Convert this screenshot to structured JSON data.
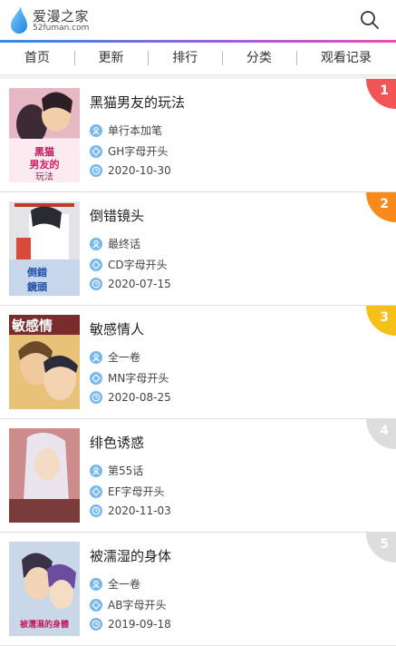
{
  "header": {
    "logo_name": "爱漫之家",
    "logo_url": "52fuman.com",
    "brand_color": "#2f8de6"
  },
  "nav": [
    "首页",
    "更新",
    "排行",
    "分类",
    "观看记录"
  ],
  "rank_colors": [
    "#f15555",
    "#f7891d",
    "#f6c01b",
    "#dddddd",
    "#dddddd"
  ],
  "items": [
    {
      "rank": "1",
      "title": "黑猫男友的玩法",
      "chapter": "单行本加笔",
      "category": "GH字母开头",
      "date": "2020-10-30",
      "cover_text": [
        "黑猫",
        "男友的",
        "玩法"
      ]
    },
    {
      "rank": "2",
      "title": "倒错镜头",
      "chapter": "最终话",
      "category": "CD字母开头",
      "date": "2020-07-15",
      "cover_text": [
        "倒錯",
        "鏡頭"
      ]
    },
    {
      "rank": "3",
      "title": "敏感情人",
      "chapter": "全一卷",
      "category": "MN字母开头",
      "date": "2020-08-25",
      "cover_text": [
        "敏感情"
      ]
    },
    {
      "rank": "4",
      "title": "绯色诱惑",
      "chapter": "第55话",
      "category": "EF字母开头",
      "date": "2020-11-03",
      "cover_text": []
    },
    {
      "rank": "5",
      "title": "被濡湿的身体",
      "chapter": "全一卷",
      "category": "AB字母开头",
      "date": "2019-09-18",
      "cover_text": [
        "被濡濕的身體"
      ]
    }
  ]
}
